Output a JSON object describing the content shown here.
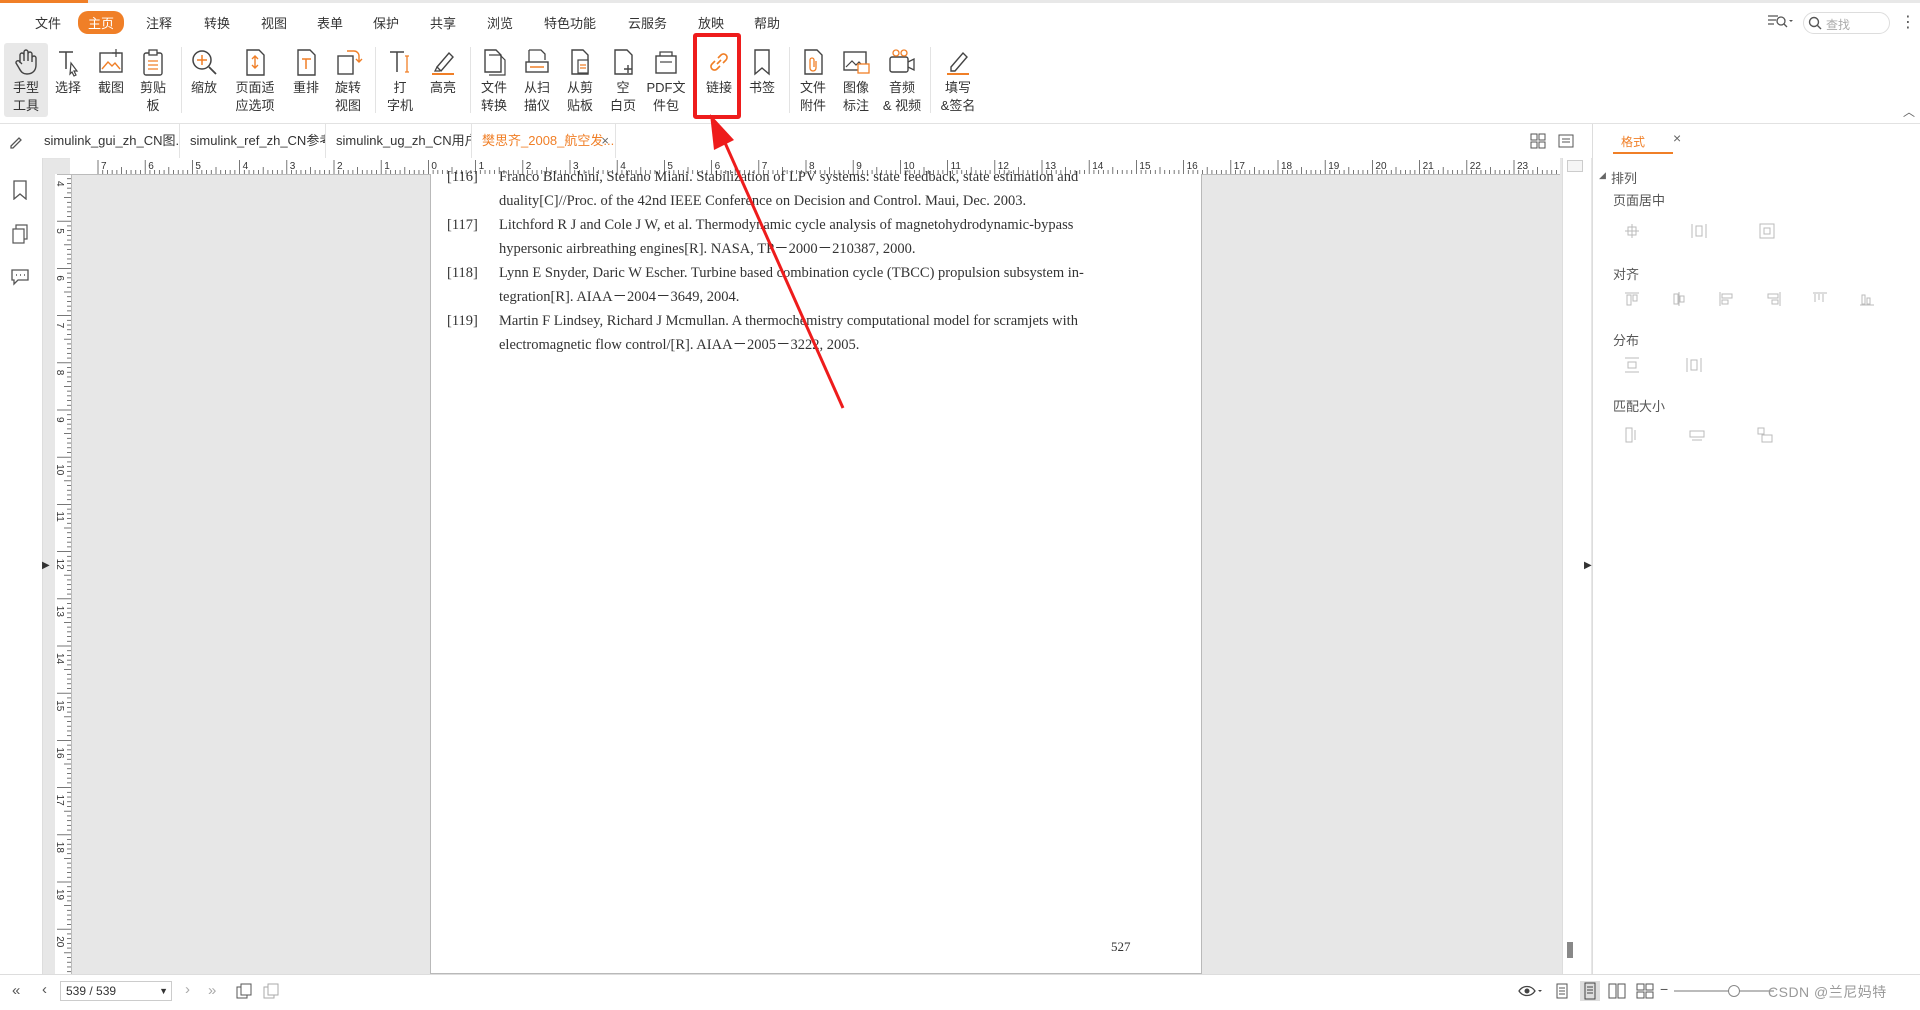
{
  "menu": {
    "items": [
      "文件",
      "主页",
      "注释",
      "转换",
      "视图",
      "表单",
      "保护",
      "共享",
      "浏览",
      "特色功能",
      "云服务",
      "放映",
      "帮助"
    ],
    "active": "主页",
    "search_placeholder": "查找"
  },
  "ribbon": {
    "tools": [
      {
        "label": "手型\n工具",
        "icon": "hand-icon"
      },
      {
        "label": "选择",
        "icon": "text-cursor-icon"
      },
      {
        "label": "截图",
        "icon": "screenshot-icon"
      },
      {
        "label": "剪贴\n板",
        "icon": "clipboard-icon"
      },
      {
        "label": "缩放",
        "icon": "zoom-icon"
      },
      {
        "label": "页面适\n应选项",
        "icon": "fit-page-icon"
      },
      {
        "label": "重排",
        "icon": "reflow-icon"
      },
      {
        "label": "旋转\n视图",
        "icon": "rotate-icon"
      },
      {
        "label": "打\n字机",
        "icon": "typewriter-icon"
      },
      {
        "label": "高亮",
        "icon": "highlight-icon"
      },
      {
        "label": "文件\n转换",
        "icon": "file-convert-icon"
      },
      {
        "label": "从扫\n描仪",
        "icon": "scanner-icon"
      },
      {
        "label": "从剪\n贴板",
        "icon": "paste-icon"
      },
      {
        "label": "空\n白页",
        "icon": "blank-page-icon"
      },
      {
        "label": "PDF文\n件包",
        "icon": "pdf-package-icon"
      },
      {
        "label": "链接",
        "icon": "link-icon"
      },
      {
        "label": "书签",
        "icon": "bookmark-icon"
      },
      {
        "label": "文件\n附件",
        "icon": "attachment-icon"
      },
      {
        "label": "图像\n标注",
        "icon": "image-annotation-icon"
      },
      {
        "label": "音频\n& 视频",
        "icon": "audio-video-icon"
      },
      {
        "label": "填写\n&签名",
        "icon": "fill-sign-icon"
      }
    ]
  },
  "tabs": [
    {
      "label": "simulink_gui_zh_CN图..."
    },
    {
      "label": "simulink_ref_zh_CN参考..."
    },
    {
      "label": "simulink_ug_zh_CN用户..."
    },
    {
      "label": "樊思齐_2008_航空发..."
    }
  ],
  "ruler": {
    "horizontal": [
      "7",
      "6",
      "5",
      "4",
      "3",
      "2",
      "1",
      "0",
      "1",
      "2",
      "3",
      "4",
      "5",
      "6",
      "7",
      "8",
      "9",
      "10",
      "11",
      "12",
      "13",
      "14",
      "15",
      "16",
      "17",
      "18",
      "19",
      "20",
      "21",
      "22",
      "23"
    ],
    "vertical": [
      "4",
      "5",
      "6",
      "7",
      "8",
      "9",
      "10",
      "11",
      "12",
      "13",
      "14",
      "15",
      "16",
      "17",
      "18",
      "19",
      "20"
    ]
  },
  "document": {
    "references": [
      {
        "num": "[116]",
        "lines": [
          "Franco Blanchini, Stefano Miani. Stabilization of LPV systems: state feedback, state estimation and",
          "duality[C]//Proc. of the 42nd IEEE Conference on Decision and Control. Maui, Dec. 2003."
        ]
      },
      {
        "num": "[117]",
        "lines": [
          "Litchford R J and Cole J W, et al. Thermodynamic cycle analysis of magnetohydrodynamic-bypass",
          "hypersonic airbreathing engines[R]. NASA, TP－2000－210387, 2000."
        ]
      },
      {
        "num": "[118]",
        "lines": [
          "Lynn E Snyder, Daric W Escher. Turbine based combination cycle (TBCC) propulsion subsystem in-",
          "tegration[R]. AIAA－2004－3649, 2004."
        ]
      },
      {
        "num": "[119]",
        "lines": [
          "Martin F Lindsey, Richard J Mcmullan. A thermochemistry computational model for scramjets with",
          "electromagnetic flow control/[R]. AIAA－2005－3222, 2005."
        ]
      }
    ],
    "page_number": "527"
  },
  "format_panel": {
    "tab": "格式",
    "section": "排列",
    "groups": [
      "页面居中",
      "对齐",
      "分布",
      "匹配大小"
    ]
  },
  "status": {
    "page_display": "539 / 539",
    "watermark": "CSDN @兰尼妈特"
  },
  "colors": {
    "accent": "#f07f27",
    "highlight": "#ee1c1c"
  }
}
